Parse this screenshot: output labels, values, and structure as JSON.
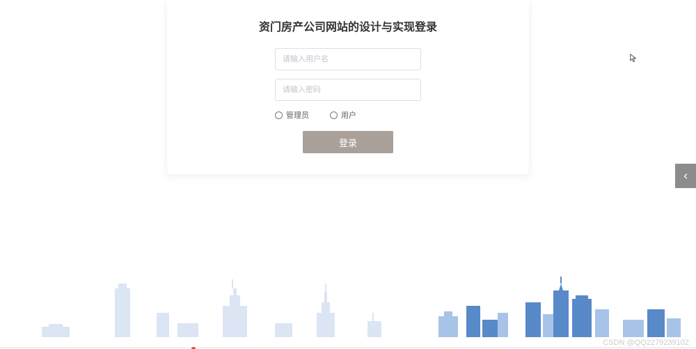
{
  "login": {
    "title": "资门房产公司网站的设计与实现登录",
    "username_placeholder": "请输入用户名",
    "password_placeholder": "请输入密码",
    "roles": {
      "admin": "管理员",
      "user": "用户"
    },
    "button_label": "登录"
  },
  "watermark": "CSDN @QQ2279239102"
}
